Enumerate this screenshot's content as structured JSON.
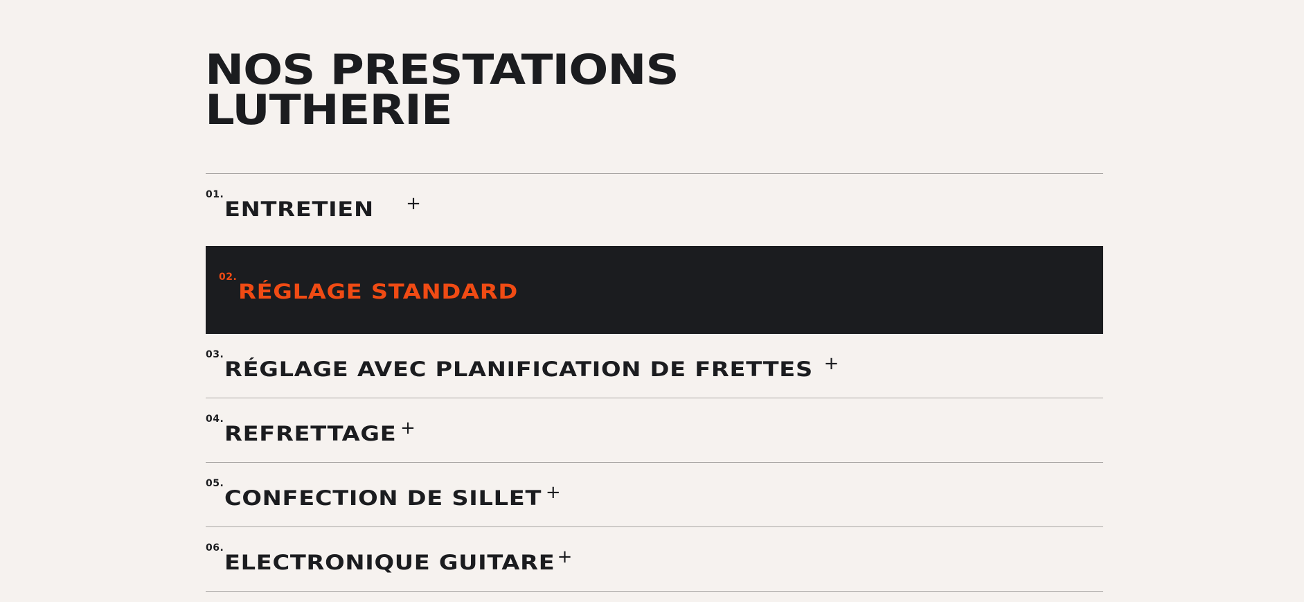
{
  "header": {
    "title_line1": "NOS PRESTATIONS",
    "title_line2": "LUTHERIE"
  },
  "services": [
    {
      "number": "01.",
      "label": "ENTRETIEN",
      "icon": "+",
      "active": false
    },
    {
      "number": "02.",
      "label": "RÉGLAGE STANDARD",
      "icon": "",
      "active": true
    },
    {
      "number": "03.",
      "label": "RÉGLAGE AVEC PLANIFICATION DE FRETTES",
      "icon": "+",
      "active": false
    },
    {
      "number": "04.",
      "label": "REFRETTAGE",
      "icon": "+",
      "active": false
    },
    {
      "number": "05.",
      "label": "CONFECTION DE SILLET",
      "icon": "+",
      "active": false
    },
    {
      "number": "06.",
      "label": "ELECTRONIQUE GUITARE",
      "icon": "+",
      "active": false
    }
  ],
  "colors": {
    "background": "#f6f2ef",
    "text": "#1b1c1f",
    "accent": "#f04b14",
    "active_background": "#1b1c1f",
    "divider": "#a9a6a4"
  }
}
